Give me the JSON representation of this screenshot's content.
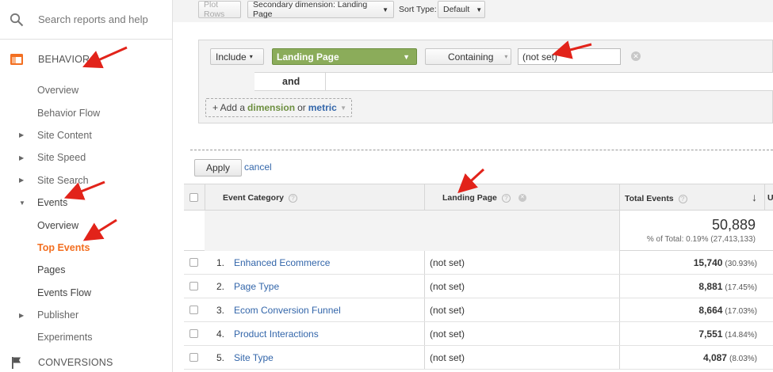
{
  "sidebar": {
    "search_placeholder": "Search reports and help",
    "behavior_label": "BEHAVIOR",
    "items": [
      {
        "label": "Overview"
      },
      {
        "label": "Behavior Flow"
      },
      {
        "label": "Site Content"
      },
      {
        "label": "Site Speed"
      },
      {
        "label": "Site Search"
      },
      {
        "label": "Events"
      },
      {
        "label": "Overview"
      },
      {
        "label": "Top Events"
      },
      {
        "label": "Pages"
      },
      {
        "label": "Events Flow"
      },
      {
        "label": "Publisher"
      },
      {
        "label": "Experiments"
      }
    ],
    "conversions_label": "CONVERSIONS"
  },
  "toolbar": {
    "plot_rows": "Plot Rows",
    "secondary_dimension": "Secondary dimension: Landing Page",
    "sort_type_label": "Sort Type:",
    "sort_type_value": "Default"
  },
  "filter": {
    "include": "Include",
    "dimension": "Landing Page",
    "match": "Containing",
    "value": "(not set)",
    "and_label": "and",
    "add_prefix": "+ Add a",
    "add_dimension": "dimension",
    "add_or": "or",
    "add_metric": "metric",
    "apply": "Apply",
    "cancel": "cancel"
  },
  "table": {
    "headers": {
      "event_category": "Event Category",
      "landing_page": "Landing Page",
      "total_events": "Total Events",
      "next_col_partial": "U"
    },
    "totals": {
      "value": "50,889",
      "pct": "% of Total: 0.19% (27,413,133)"
    },
    "rows": [
      {
        "num": "1.",
        "category": "Enhanced Ecommerce",
        "landing": "(not set)",
        "events": "15,740",
        "pct": "(30.93%)"
      },
      {
        "num": "2.",
        "category": "Page Type",
        "landing": "(not set)",
        "events": "8,881",
        "pct": "(17.45%)"
      },
      {
        "num": "3.",
        "category": "Ecom Conversion Funnel",
        "landing": "(not set)",
        "events": "8,664",
        "pct": "(17.03%)"
      },
      {
        "num": "4.",
        "category": "Product Interactions",
        "landing": "(not set)",
        "events": "7,551",
        "pct": "(14.84%)"
      },
      {
        "num": "5.",
        "category": "Site Type",
        "landing": "(not set)",
        "events": "4,087",
        "pct": "(8.03%)"
      }
    ]
  },
  "colors": {
    "accent_orange": "#f36f21",
    "link_blue": "#3366aa",
    "dimension_green": "#8bac5a",
    "annotation_red": "#e2231a"
  }
}
